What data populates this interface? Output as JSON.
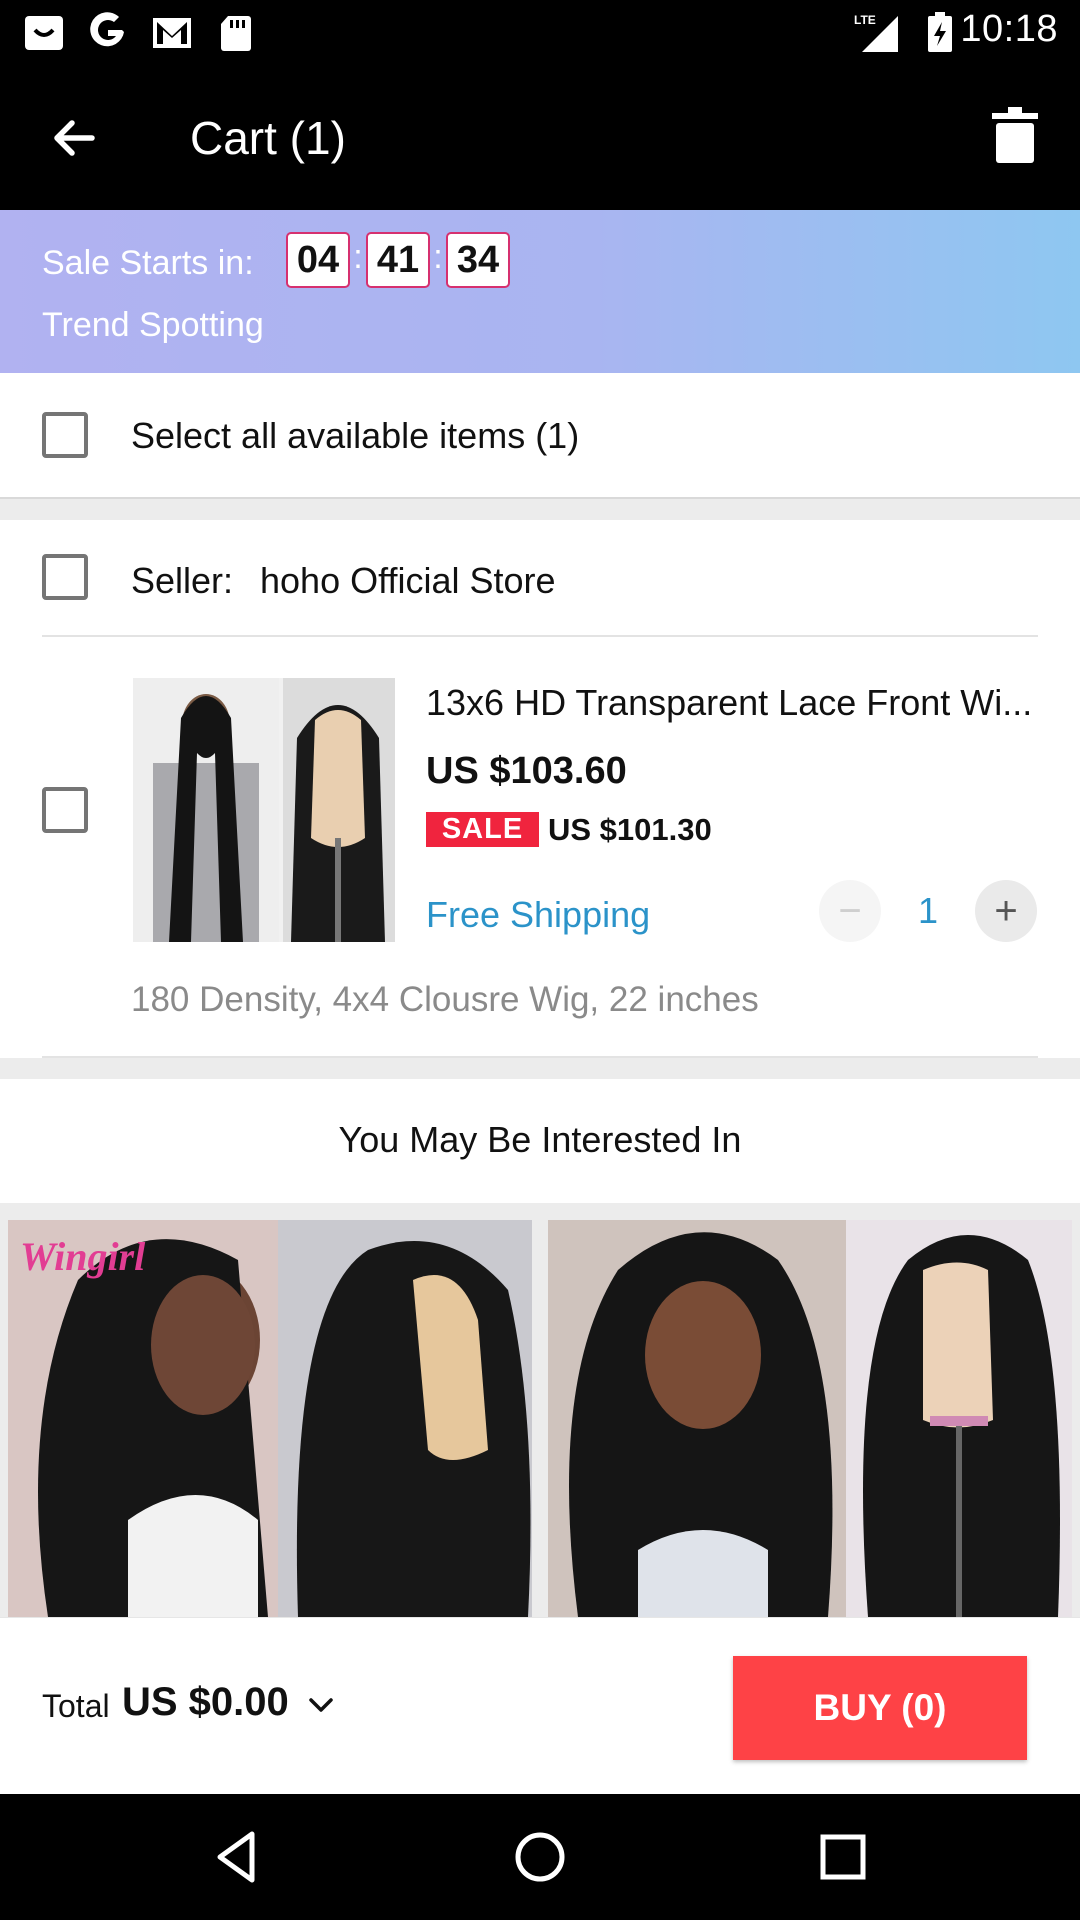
{
  "status_bar": {
    "time": "10:18",
    "notification_icons": [
      "shopping-bag-icon",
      "google-icon",
      "gmail-icon",
      "sd-card-icon"
    ],
    "system_icons": [
      "lte-signal-icon",
      "battery-charging-icon"
    ],
    "network_label": "LTE"
  },
  "app_bar": {
    "title": "Cart (1)",
    "back_icon": "arrow-left-icon",
    "delete_icon": "trash-icon"
  },
  "sale_banner": {
    "label": "Sale Starts in:",
    "countdown": {
      "hours": "04",
      "minutes": "41",
      "seconds": "34"
    },
    "separator": ":",
    "subtitle": "Trend Spotting"
  },
  "select_all": {
    "label": "Select all available items (1)",
    "checked": false
  },
  "store": {
    "seller_label": "Seller:",
    "seller_name": "hoho Official Store",
    "checked": false
  },
  "cart_item": {
    "title": "13x6 HD Transparent Lace Front Wi...",
    "price": "US $103.60",
    "sale_badge": "SALE",
    "sale_price": "US $101.30",
    "shipping": "Free Shipping",
    "quantity": "1",
    "minus_symbol": "−",
    "plus_symbol": "+",
    "variant": "180 Density, 4x4 Clousre Wig, 22 inches",
    "checked": false
  },
  "recommendations": {
    "title": "You May Be Interested In",
    "cards": [
      {
        "brand_watermark": "Wingirl"
      },
      {
        "brand_watermark": ""
      }
    ]
  },
  "bottom_bar": {
    "total_label": "Total",
    "total_value": "US $0.00",
    "buy_label": "BUY (0)"
  },
  "colors": {
    "buy_button": "#fe4246",
    "sale_badge": "#f0243e",
    "link_blue": "#2b93c9",
    "banner_start": "#b1b2f1",
    "banner_end": "#8ec7f1",
    "countdown_border": "#d6306f"
  }
}
